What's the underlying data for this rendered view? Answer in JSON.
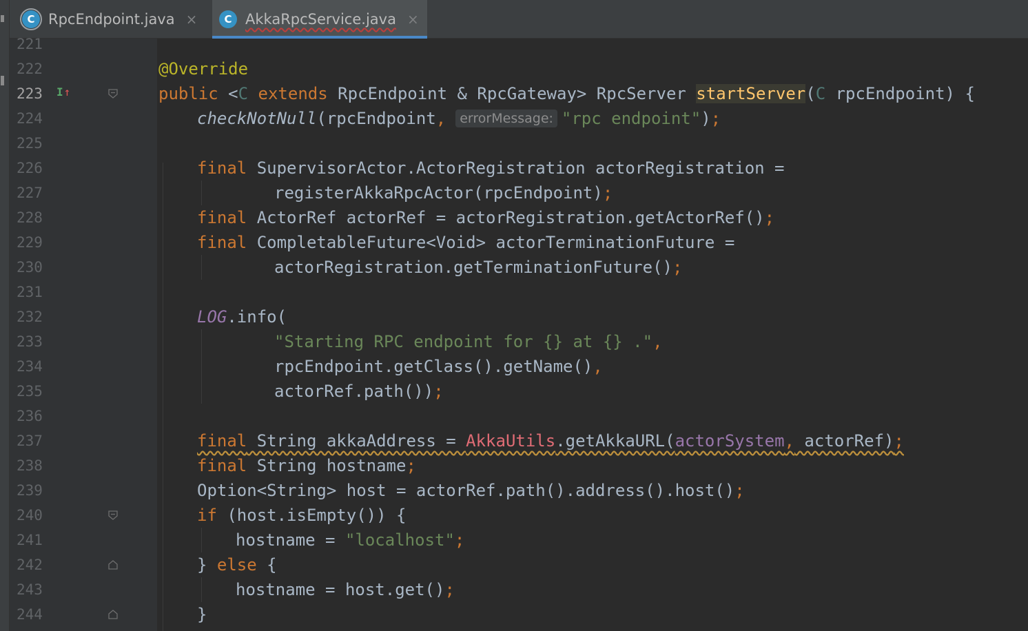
{
  "tabs": [
    {
      "name": "RpcEndpoint.java",
      "icon": "class-icon",
      "active": false
    },
    {
      "name": "AkkaRpcService.java",
      "icon": "class-icon",
      "active": true
    }
  ],
  "close_glyph": "×",
  "class_glyph": "C",
  "hint_label": "errorMessage:",
  "current_line": "223",
  "colors": {
    "keyword": "#cc7832",
    "string": "#6a8759",
    "annotation": "#bbb529",
    "method_decl": "#ffc66d",
    "static_field": "#9876aa",
    "text": "#a9b7c6",
    "accent": "#4a88c7"
  },
  "code_lines": [
    {
      "n": "221",
      "text": ""
    },
    {
      "n": "222",
      "text": "@Override"
    },
    {
      "n": "223",
      "text": "public <C extends RpcEndpoint & RpcGateway> RpcServer startServer(C rpcEndpoint) {"
    },
    {
      "n": "224",
      "text": "checkNotNull(rpcEndpoint,  errorMessage: \"rpc endpoint\");"
    },
    {
      "n": "225",
      "text": ""
    },
    {
      "n": "226",
      "text": "final SupervisorActor.ActorRegistration actorRegistration ="
    },
    {
      "n": "227",
      "text": "registerAkkaRpcActor(rpcEndpoint);"
    },
    {
      "n": "228",
      "text": "final ActorRef actorRef = actorRegistration.getActorRef();"
    },
    {
      "n": "229",
      "text": "final CompletableFuture<Void> actorTerminationFuture ="
    },
    {
      "n": "230",
      "text": "actorRegistration.getTerminationFuture();"
    },
    {
      "n": "231",
      "text": ""
    },
    {
      "n": "232",
      "text": "LOG.info("
    },
    {
      "n": "233",
      "text": "\"Starting RPC endpoint for {} at {} .\","
    },
    {
      "n": "234",
      "text": "rpcEndpoint.getClass().getName(),"
    },
    {
      "n": "235",
      "text": "actorRef.path());"
    },
    {
      "n": "236",
      "text": ""
    },
    {
      "n": "237",
      "text": "final String akkaAddress = AkkaUtils.getAkkaURL(actorSystem, actorRef);"
    },
    {
      "n": "238",
      "text": "final String hostname;"
    },
    {
      "n": "239",
      "text": "Option<String> host = actorRef.path().address().host();"
    },
    {
      "n": "240",
      "text": "if (host.isEmpty()) {"
    },
    {
      "n": "241",
      "text": "hostname = \"localhost\";"
    },
    {
      "n": "242",
      "text": "} else {"
    },
    {
      "n": "243",
      "text": "hostname = host.get();"
    },
    {
      "n": "244",
      "text": "}"
    }
  ]
}
